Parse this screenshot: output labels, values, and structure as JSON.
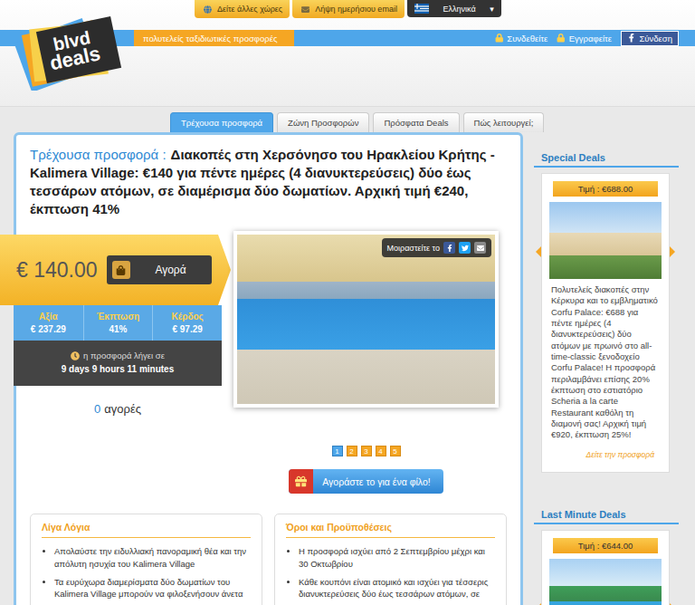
{
  "top_links": [
    {
      "label": "Δείτε άλλες χώρες",
      "kind": "globe"
    },
    {
      "label": "Λήψη ημερήσιου email",
      "kind": "mail"
    }
  ],
  "language": {
    "label": "Ελληνικά",
    "caret": "▾"
  },
  "logo": {
    "line1": "blvd",
    "line2": "deals"
  },
  "tagline": "πολυτελείς ταξιδιωτικές προσφορές",
  "account": [
    {
      "label": "Συνδεθείτε",
      "kind": "lock"
    },
    {
      "label": "Εγγραφείτε",
      "kind": "lock"
    },
    {
      "label": "Σύνδεση",
      "kind": "facebook"
    }
  ],
  "nav_tabs": [
    {
      "label": "Τρέχουσα προσφορά",
      "selected": true
    },
    {
      "label": "Ζώνη Προσφορών",
      "selected": false
    },
    {
      "label": "Πρόσφατα Deals",
      "selected": false
    },
    {
      "label": "Πώς λειτουργεί;",
      "selected": false
    }
  ],
  "deal": {
    "heading_label": "Τρέχουσα προσφορά :",
    "heading_text": "Διακοπές στη Χερσόνησο του Ηρακλείου Κρήτης - Kalimera Village: €140 για πέντε ημέρες (4 διανυκτερεύσεις) δύο έως τεσσάρων ατόμων, σε διαμέρισμα δύο δωματίων. Αρχική τιμή €240, έκπτωση 41%",
    "price": "€ 140.00",
    "buy_label": "Αγορά",
    "stats": [
      {
        "label": "Αξία",
        "value": "€ 237.29"
      },
      {
        "label": "Έκπτωση",
        "value": "41%"
      },
      {
        "label": "Κέρδος",
        "value": "€ 97.29"
      }
    ],
    "timer_label": "η προσφορά λήγει σε",
    "timer_value": "9 days 9 hours 11 minutes",
    "purchase_count": "0",
    "purchase_label": "αγορές",
    "share_label": "Μοιραστείτε το",
    "pages": [
      {
        "label": "1",
        "selected": true
      },
      {
        "label": "2",
        "selected": false
      },
      {
        "label": "3",
        "selected": false
      },
      {
        "label": "4",
        "selected": false
      },
      {
        "label": "5",
        "selected": false
      }
    ],
    "gift_label": "Αγοράστε το για ένα φίλο!"
  },
  "info_boxes": [
    {
      "title": "Λίγα Λόγια",
      "items": [
        "Απολαύστε την ειδυλλιακή πανοραμική θέα και την απόλυτη ησυχία του Kalimera Village",
        "Τα ευρύχωρα διαμερίσματα δύο δωματίων του Kalimera Village μπορούν να φιλοξενήσουν άνετα"
      ]
    },
    {
      "title": "Όροι και Προϋποθέσεις",
      "items": [
        "Η προσφορά ισχύει από 2 Σεπτεμβρίου μέχρι και 30 Οκτωβρίου",
        "Κάθε κουπόνι είναι ατομικό και ισχύει για τέσσερις διανυκτερεύσεις δύο έως τεσσάρων ατόμων, σε"
      ]
    }
  ],
  "sidebar": [
    {
      "title": "Special Deals",
      "price": "Τιμή : €688.00",
      "text": "Πολυτελείς διακοπές στην Κέρκυρα και το εμβληματικό Corfu Palace: €688 για πέντε ημέρες (4 διανυκτερεύσεις) δύο ατόμων με πρωινό στο all-time-classic ξενοδοχείο Corfu Palace! Η προσφορά περιλαμβάνει επίσης 20% έκπτωση στο εστιατόριο Scheria a la carte Restaurant καθόλη τη διαμονή σας! Αρχική τιμή €920, έκπτωση 25%!",
      "link": "Δείτε την προσφορά"
    },
    {
      "title": "Last Minute Deals",
      "price": "Τιμή : €644.00",
      "text": "",
      "link": ""
    }
  ]
}
